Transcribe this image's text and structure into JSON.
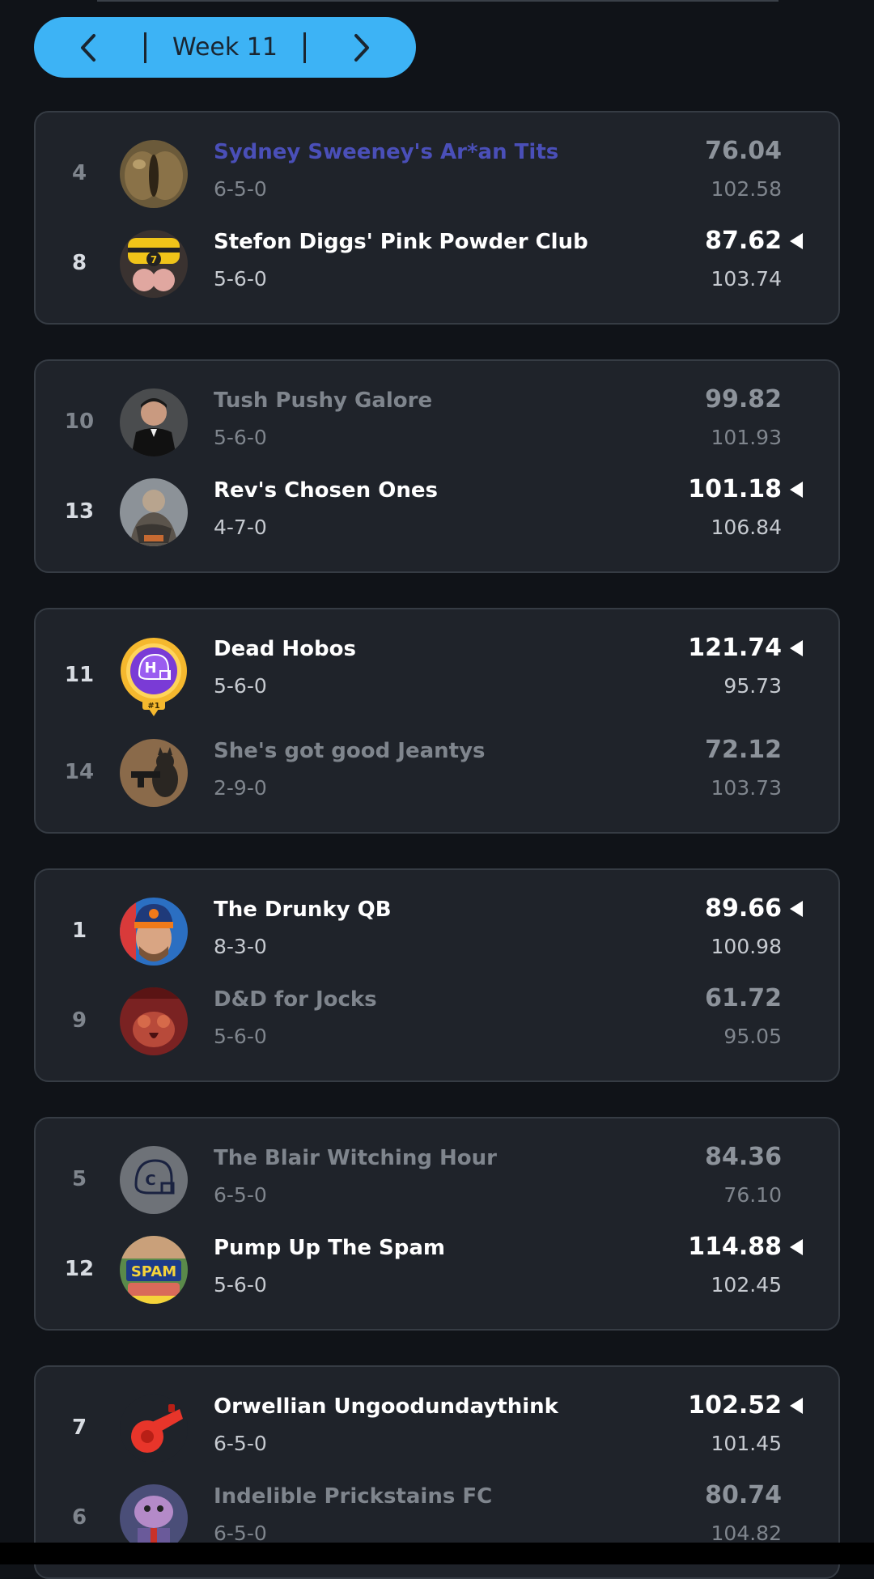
{
  "week_selector": {
    "label": "Week 11",
    "prev_icon": "chevron-left-icon",
    "next_icon": "chevron-right-icon",
    "color": "#3db3f5"
  },
  "matchups": [
    {
      "teams": [
        {
          "rank": "4",
          "name": "Sydney Sweeney's Ar*an Tits",
          "record": "6-5-0",
          "score": "76.04",
          "projected": "102.58",
          "winner": false,
          "highlight": true,
          "avatar": "eyeball-avatar"
        },
        {
          "rank": "8",
          "name": "Stefon Diggs' Pink Powder Club",
          "record": "5-6-0",
          "score": "87.62",
          "projected": "103.74",
          "winner": true,
          "highlight": false,
          "avatar": "beanie-avatar"
        }
      ]
    },
    {
      "teams": [
        {
          "rank": "10",
          "name": "Tush Pushy Galore",
          "record": "5-6-0",
          "score": "99.82",
          "projected": "101.93",
          "winner": false,
          "highlight": false,
          "avatar": "spy-avatar"
        },
        {
          "rank": "13",
          "name": "Rev's Chosen Ones",
          "record": "4-7-0",
          "score": "101.18",
          "projected": "106.84",
          "winner": true,
          "highlight": false,
          "avatar": "painting-avatar"
        }
      ]
    },
    {
      "teams": [
        {
          "rank": "11",
          "name": "Dead Hobos",
          "record": "5-6-0",
          "score": "121.74",
          "projected": "95.73",
          "winner": true,
          "highlight": false,
          "avatar": "champion-helmet-avatar",
          "badge": "#1"
        },
        {
          "rank": "14",
          "name": "She's got good Jeantys",
          "record": "2-9-0",
          "score": "72.12",
          "projected": "103.73",
          "winner": false,
          "highlight": false,
          "avatar": "cat-avatar"
        }
      ]
    },
    {
      "teams": [
        {
          "rank": "1",
          "name": "The Drunky QB",
          "record": "8-3-0",
          "score": "89.66",
          "projected": "100.98",
          "winner": true,
          "highlight": false,
          "avatar": "man-beanie-avatar"
        },
        {
          "rank": "9",
          "name": "D&D for Jocks",
          "record": "5-6-0",
          "score": "61.72",
          "projected": "95.05",
          "winner": false,
          "highlight": false,
          "avatar": "poster-avatar"
        }
      ]
    },
    {
      "teams": [
        {
          "rank": "5",
          "name": "The Blair Witching Hour",
          "record": "6-5-0",
          "score": "84.36",
          "projected": "76.10",
          "winner": false,
          "highlight": false,
          "avatar": "gray-helmet-avatar"
        },
        {
          "rank": "12",
          "name": "Pump Up The Spam",
          "record": "5-6-0",
          "score": "114.88",
          "projected": "102.45",
          "winner": true,
          "highlight": false,
          "avatar": "spam-avatar"
        }
      ]
    },
    {
      "teams": [
        {
          "rank": "7",
          "name": "Orwellian Ungoodundaythink",
          "record": "6-5-0",
          "score": "102.52",
          "projected": "101.45",
          "winner": true,
          "highlight": false,
          "avatar": "whistle-avatar"
        },
        {
          "rank": "6",
          "name": "Indelible Prickstains FC",
          "record": "6-5-0",
          "score": "80.74",
          "projected": "104.82",
          "winner": false,
          "highlight": false,
          "avatar": "cartoon-avatar"
        }
      ]
    }
  ]
}
